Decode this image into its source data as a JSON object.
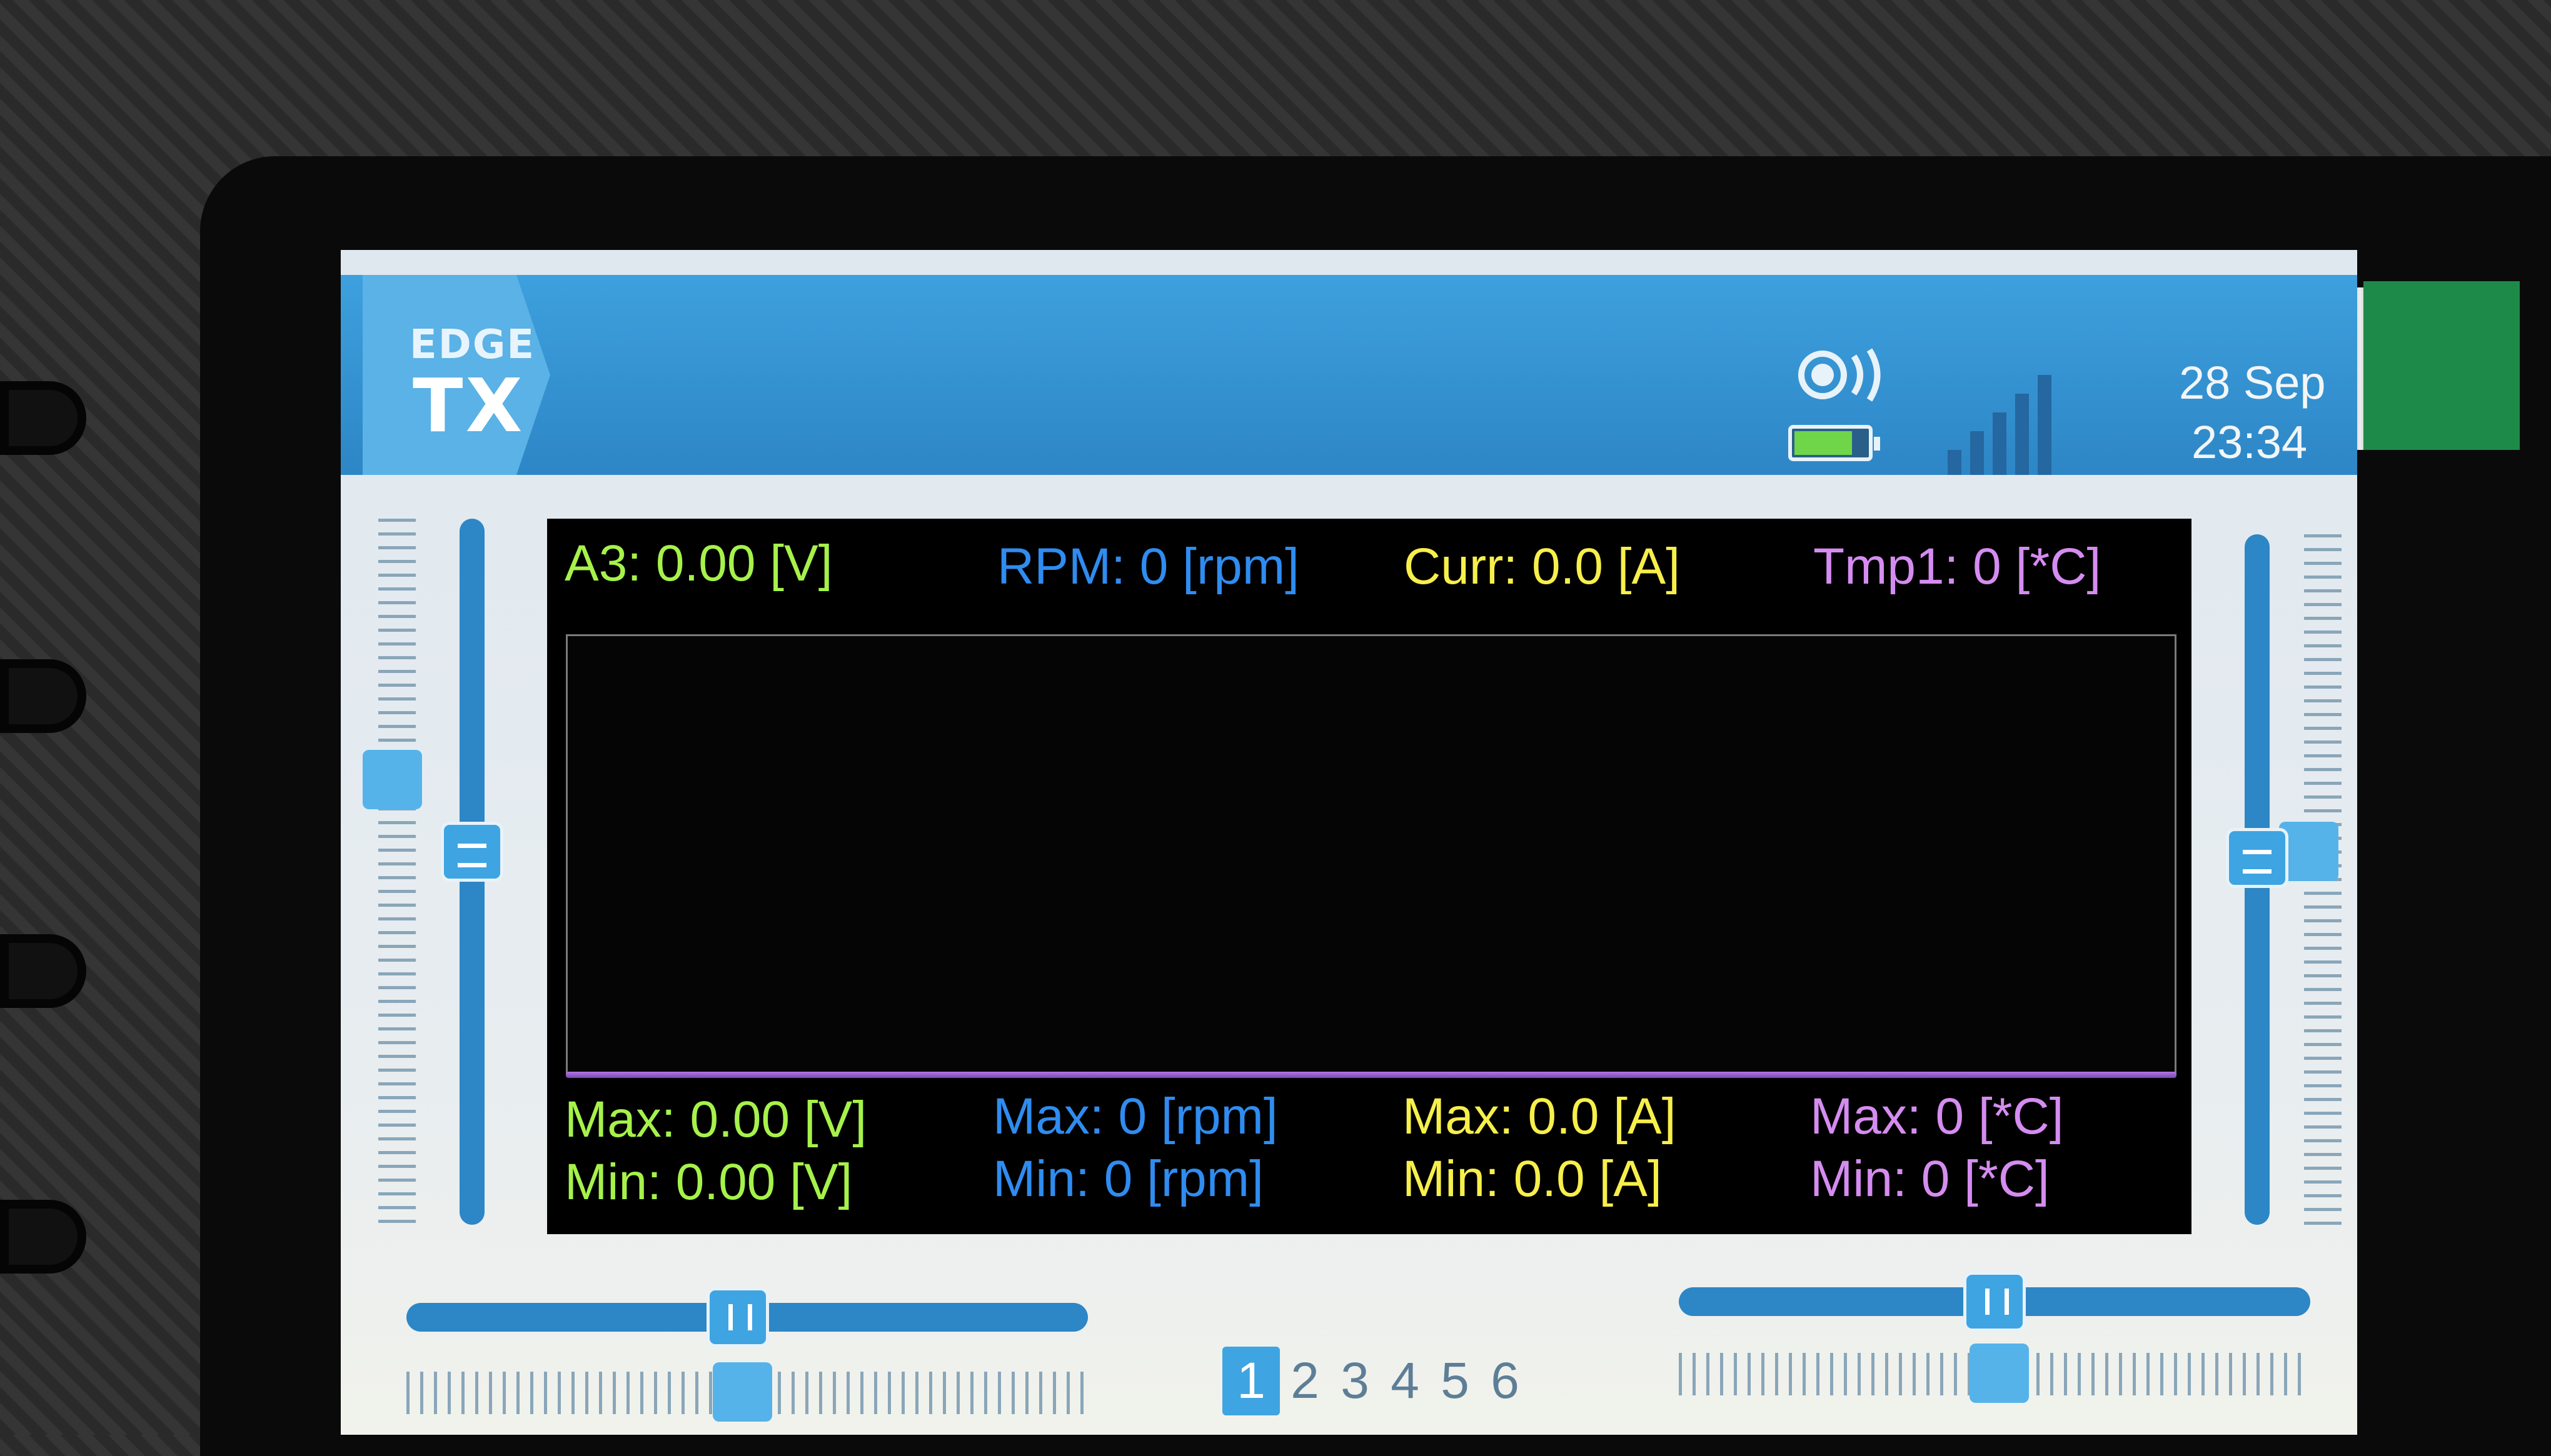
{
  "header": {
    "logo_top": "EDGE",
    "logo_bottom": "TX",
    "date": "28 Sep",
    "time": "23:34",
    "battery_level": 0.8,
    "icons": [
      "rf-signal-icon",
      "battery-icon",
      "signal-strength-icon"
    ]
  },
  "telemetry": {
    "a3_current": "A3: 0.00 [V]",
    "rpm_current": "RPM: 0 [rpm]",
    "curr_current": "Curr: 0.0 [A]",
    "tmp1_current": "Tmp1: 0 [*C]",
    "a3_max": "Max: 0.00 [V]",
    "a3_min": "Min: 0.00 [V]",
    "rpm_max": "Max: 0 [rpm]",
    "rpm_min": "Min: 0 [rpm]",
    "curr_max": "Max: 0.0 [A]",
    "curr_min": "Min: 0.0 [A]",
    "tmp1_max": "Max: 0 [*C]",
    "tmp1_min": "Min: 0 [*C]"
  },
  "pages": {
    "items": [
      "1",
      "2",
      "3",
      "4",
      "5",
      "6"
    ],
    "active": "1"
  },
  "colors": {
    "header_blue": "#2d86c6",
    "a3_green": "#a6f24a",
    "rpm_blue": "#2f8cf0",
    "curr_yellow": "#f7ef4a",
    "tmp1_purple": "#d58cf0"
  }
}
